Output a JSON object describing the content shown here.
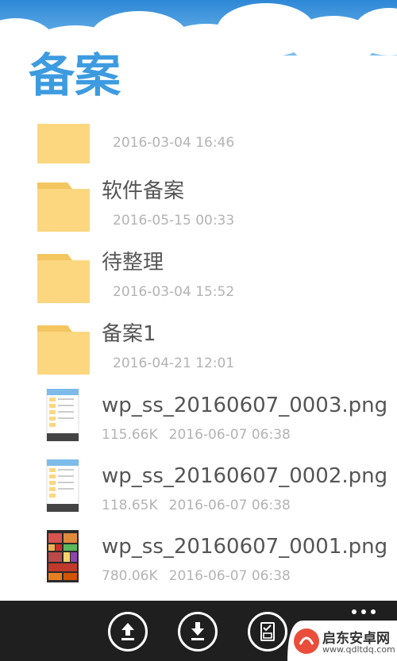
{
  "page": {
    "title": "备案"
  },
  "files": [
    {
      "name": "",
      "size": "",
      "date": "2016-03-04 16:46",
      "type": "folder"
    },
    {
      "name": "软件备案",
      "size": "",
      "date": "2016-05-15 00:33",
      "type": "folder"
    },
    {
      "name": "待整理",
      "size": "",
      "date": "2016-03-04 15:52",
      "type": "folder"
    },
    {
      "name": "备案1",
      "size": "",
      "date": "2016-04-21 12:01",
      "type": "folder"
    },
    {
      "name": "wp_ss_20160607_0003.png",
      "size": "115.66K",
      "date": "2016-06-07 06:38",
      "type": "image-light"
    },
    {
      "name": "wp_ss_20160607_0002.png",
      "size": "118.65K",
      "date": "2016-06-07 06:38",
      "type": "image-light"
    },
    {
      "name": "wp_ss_20160607_0001.png",
      "size": "780.06K",
      "date": "2016-06-07 06:38",
      "type": "image-colorful"
    }
  ],
  "appbar": {
    "buttons": [
      "upload-icon",
      "download-icon",
      "select-icon"
    ],
    "more": "more-icon"
  },
  "watermark": {
    "text": "启东安卓网",
    "url": "www.qdltdq.com"
  },
  "colors": {
    "title": "#3d9be0",
    "folder": "#fcd780",
    "folder_tab": "#f4c660",
    "appbar": "#1f1f1f",
    "sky": "#2f8fd8"
  }
}
